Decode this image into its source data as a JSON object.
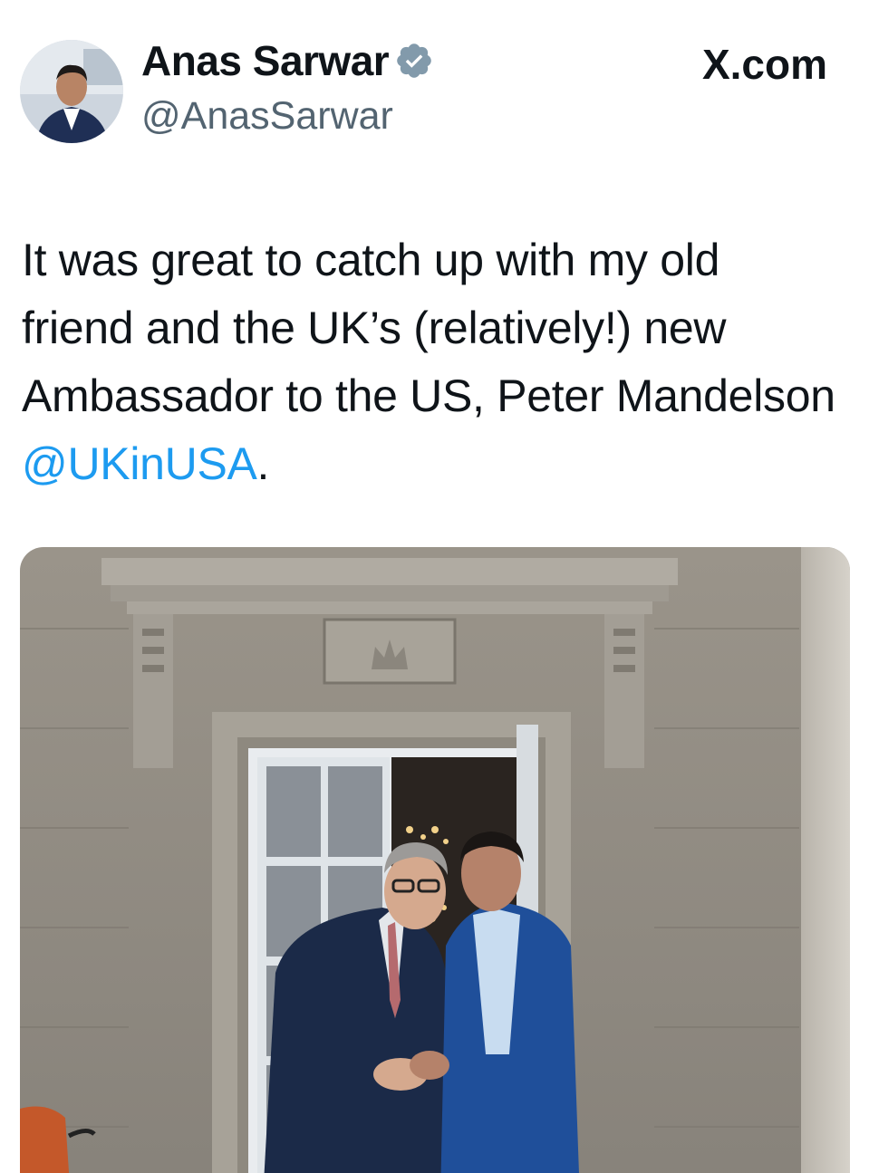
{
  "author": {
    "display_name": "Anas Sarwar",
    "handle": "@AnasSarwar",
    "verified": true,
    "avatar_icon": "profile-photo"
  },
  "source": {
    "label": "X.com"
  },
  "tweet": {
    "text_part1": "It was great to catch up with my old friend and the UK’s (relatively!) new Ambassador to the US, Peter Mandelson ",
    "mention": "@UKinUSA",
    "text_part2": "."
  },
  "colors": {
    "text": "#0f1419",
    "secondary_text": "#536471",
    "link": "#1d9bf0",
    "verified_badge": "#829aab"
  },
  "media": {
    "type": "photo"
  }
}
